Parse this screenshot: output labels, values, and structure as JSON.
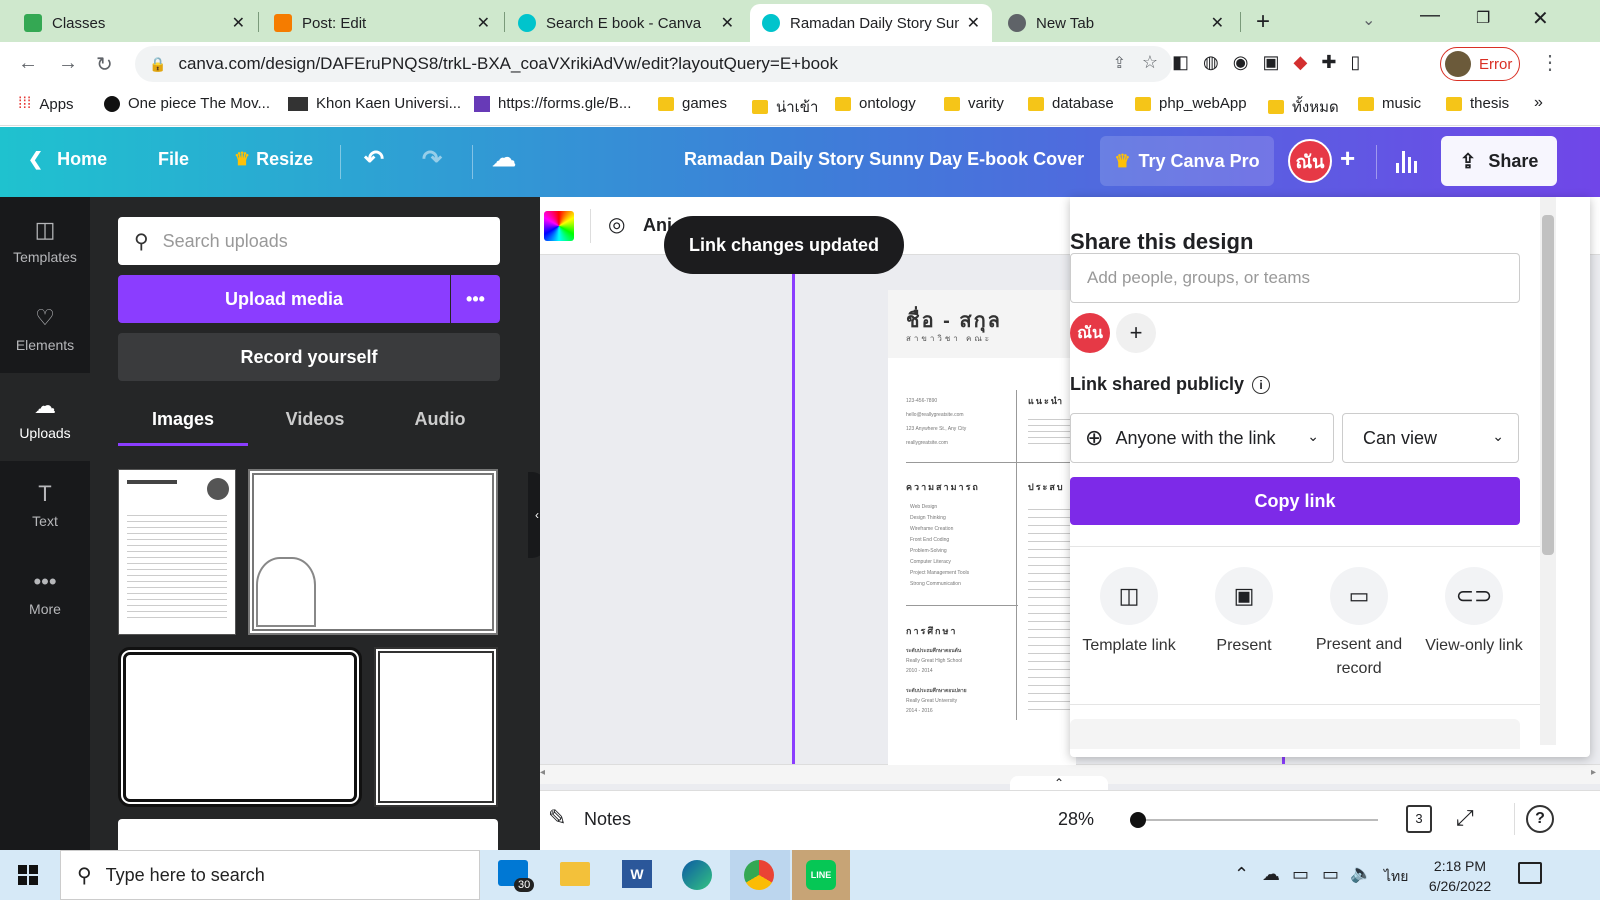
{
  "browser": {
    "tabs": [
      {
        "title": "Classes",
        "favicon_color": "#34a853"
      },
      {
        "title": "Post: Edit",
        "favicon_color": "#f57c00"
      },
      {
        "title": "Search E book - Canva",
        "favicon_color": "#00c4cc"
      },
      {
        "title": "Ramadan Daily Story Sunny",
        "favicon_color": "#00c4cc"
      },
      {
        "title": "New Tab",
        "favicon_color": "#5f6368"
      }
    ],
    "url": "canva.com/design/DAFEruPNQS8/trkL-BXA_coaVXrikiAdVw/edit?layoutQuery=E+book",
    "profile_label": "Error",
    "bookmarks": [
      "Apps",
      "One piece The Mov...",
      "Khon Kaen Universi...",
      "https://forms.gle/B...",
      "games",
      "น่าเข้า",
      "ontology",
      "varity",
      "database",
      "php_webApp",
      "ทั้งหมด",
      "music",
      "thesis"
    ]
  },
  "header": {
    "home": "Home",
    "file": "File",
    "resize": "Resize",
    "design_title": "Ramadan Daily Story Sunny Day E-book Cover",
    "try_pro": "Try Canva Pro",
    "avatar_text": "ณัน",
    "share": "Share"
  },
  "leftnav": [
    {
      "label": "Templates",
      "icon": "templates-icon"
    },
    {
      "label": "Elements",
      "icon": "elements-icon"
    },
    {
      "label": "Uploads",
      "icon": "uploads-icon"
    },
    {
      "label": "Text",
      "icon": "text-icon"
    },
    {
      "label": "More",
      "icon": "more-icon"
    }
  ],
  "panel": {
    "search_placeholder": "Search uploads",
    "upload_media": "Upload media",
    "record_yourself": "Record yourself",
    "tabs": [
      "Images",
      "Videos",
      "Audio"
    ]
  },
  "toolbar": {
    "animate": "Ani",
    "toast": "Link changes updated"
  },
  "resume": {
    "name": "ชื่อ - สกุล",
    "subtitle": "สาขาวิชา คณะ",
    "phone": "123-456-7890",
    "email": "hello@reallygreatsite.com",
    "address": "123 Anywhere St., Any City",
    "site": "reallygreatsite.com",
    "skills_heading": "ความสามารถ",
    "skills": [
      "Web Design",
      "Design Thinking",
      "Wireframe Creation",
      "Front End Coding",
      "Problem-Solving",
      "Computer Literacy",
      "Project Management Tools",
      "Strong Communication"
    ],
    "education_heading": "การศึกษา",
    "edu1_title": "ระดับประถมศึกษาตอนต้น",
    "edu1_school": "Really Great High School",
    "edu1_years": "2010 - 2014",
    "edu2_title": "ระดับประถมศึกษาตอนปลาย",
    "edu2_school": "Really Great University",
    "edu2_years": "2014 - 2016",
    "about_heading": "แนะนำ",
    "exp_heading": "ประสบ"
  },
  "share_panel": {
    "title": "Share this design",
    "add_placeholder": "Add people, groups, or teams",
    "avatar_text": "ณัน",
    "link_label": "Link shared publicly",
    "access": "Anyone with the link",
    "permission": "Can view",
    "copy_link": "Copy link",
    "options": [
      "Template link",
      "Present",
      "Present and record",
      "View-only link"
    ]
  },
  "bottom": {
    "notes": "Notes",
    "zoom": "28%",
    "zoom_fraction": 0.0,
    "page_count": "3"
  },
  "taskbar": {
    "search_placeholder": "Type here to search",
    "mail_badge": "30",
    "time": "2:18 PM",
    "date": "6/26/2022",
    "lang": "ไทย"
  }
}
